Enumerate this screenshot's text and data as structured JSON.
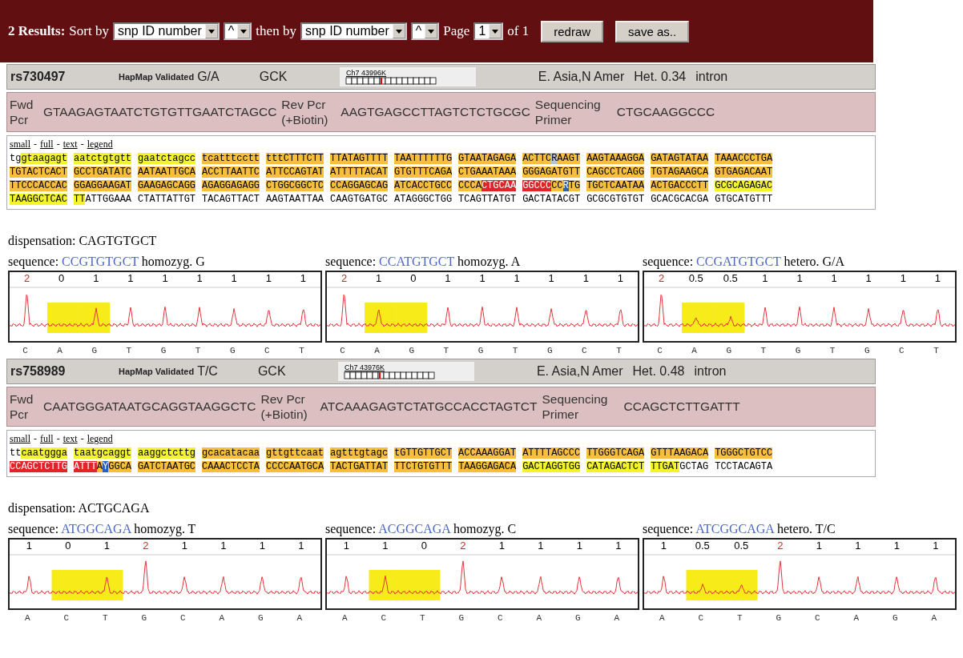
{
  "toolbar": {
    "results": "2 Results:",
    "sort_label": "Sort by",
    "sort_field": "snp ID number",
    "sort_order": "^",
    "then_label": "then by",
    "then_field": "snp ID number",
    "then_order": "^",
    "page_label": "Page",
    "page": "1",
    "page_total": "of 1",
    "buttons": [
      "redraw",
      "save as.."
    ]
  },
  "snps": [
    {
      "id": "rs730497",
      "validation": "HapMap Validated",
      "alleles": "G/A",
      "gene": "GCK",
      "chrom_label": "Ch7 43996K",
      "populations": "E. Asia,N Amer",
      "het": "Het. 0.34",
      "region": "intron",
      "primers": [
        {
          "label": "Fwd Pcr",
          "sequence": "GTAAGAGTAATCTGTGTTGAATCTAGCC"
        },
        {
          "label": "Rev Pcr (+Biotin)",
          "sequence": "AAGTGAGCCTTAGTCTCTGCGC"
        },
        {
          "label": "Sequencing Primer",
          "sequence": "CTGCAAGGCCC"
        }
      ],
      "views": [
        {
          "kind": "link",
          "text": "small"
        },
        {
          "kind": "sep",
          "text": "-"
        },
        {
          "kind": "link",
          "text": "full"
        },
        {
          "kind": "sep",
          "text": "-"
        },
        {
          "kind": "link",
          "text": "text"
        },
        {
          "kind": "sep",
          "text": "-"
        },
        {
          "kind": "link",
          "text": "legend"
        }
      ],
      "sequence_rows": [
        [
          [
            {
              "t": "tg"
            },
            {
              "t": "gtaagagt",
              "color": "#f4f42a"
            }
          ],
          [
            {
              "t": "aatctgtgtt",
              "color": "#f4f42a"
            }
          ],
          [
            {
              "t": "gaatctagcc",
              "color": "#f4f42a"
            }
          ],
          [
            {
              "t": "tcatttcctt",
              "color": "#f8bf3d"
            }
          ],
          [
            {
              "t": "tttCTTTCTT",
              "color": "#f8bf3d"
            }
          ],
          [
            {
              "t": "TTATAGTTTT",
              "color": "#f8bf3d"
            }
          ],
          [
            {
              "t": "TAATTTTTTG",
              "color": "#f8bf3d"
            }
          ],
          [
            {
              "t": "GTAATAGAGA",
              "color": "#f8bf3d"
            }
          ],
          [
            {
              "t": "ACTTC",
              "color": "#f8bf3d"
            },
            {
              "t": "R",
              "color": "#b7c3d6"
            },
            {
              "t": "AAGT",
              "color": "#f8bf3d"
            }
          ],
          [
            {
              "t": "AAGTAAAGGA",
              "color": "#f8bf3d"
            }
          ],
          [
            {
              "t": "GATAGTATAA",
              "color": "#f8bf3d"
            }
          ],
          [
            {
              "t": "TAAACCCTGA",
              "color": "#f8bf3d"
            }
          ]
        ],
        [
          [
            {
              "t": "TGTACTCACT",
              "color": "#f8bf3d"
            }
          ],
          [
            {
              "t": "GCCTGATATC",
              "color": "#f8bf3d"
            }
          ],
          [
            {
              "t": "AATAATTGCA",
              "color": "#f8bf3d"
            }
          ],
          [
            {
              "t": "ACCTTAATTC",
              "color": "#f8bf3d"
            }
          ],
          [
            {
              "t": "ATTCCAGTAT",
              "color": "#f8bf3d"
            }
          ],
          [
            {
              "t": "ATTTTTACAT",
              "color": "#f8bf3d"
            }
          ],
          [
            {
              "t": "GTGTTTCAGA",
              "color": "#f8bf3d"
            }
          ],
          [
            {
              "t": "CTGAAATAAA",
              "color": "#f8bf3d"
            }
          ],
          [
            {
              "t": "GGGAGATGTT",
              "color": "#f8bf3d"
            }
          ],
          [
            {
              "t": "CAGCCTCAGG",
              "color": "#f8bf3d"
            }
          ],
          [
            {
              "t": "TGTAGAAGCA",
              "color": "#f8bf3d"
            }
          ],
          [
            {
              "t": "GTGAGACAAT",
              "color": "#f8bf3d"
            }
          ]
        ],
        [
          [
            {
              "t": "TTCCCACCAC",
              "color": "#f8bf3d"
            }
          ],
          [
            {
              "t": "GGAGGAAGAT",
              "color": "#f8bf3d"
            }
          ],
          [
            {
              "t": "GAAGAGCAGG",
              "color": "#f8bf3d"
            }
          ],
          [
            {
              "t": "AGAGGAGAGG",
              "color": "#f8bf3d"
            }
          ],
          [
            {
              "t": "CTGGCGGCTC",
              "color": "#f8bf3d"
            }
          ],
          [
            {
              "t": "CCAGGAGCAG",
              "color": "#f8bf3d"
            }
          ],
          [
            {
              "t": "ATCACCTGCC",
              "color": "#f8bf3d"
            }
          ],
          [
            {
              "t": "CCCA",
              "color": "#f8bf3d"
            },
            {
              "t": "CTGCAA",
              "color": "#e2232a"
            }
          ],
          [
            {
              "t": "GGCCC",
              "color": "#e2232a"
            },
            {
              "t": "CC",
              "color": "#f8bf3d"
            },
            {
              "t": "R",
              "color": "#2d5fbf"
            },
            {
              "t": "TG",
              "color": "#f8bf3d"
            }
          ],
          [
            {
              "t": "TGCTCAATAA",
              "color": "#f8bf3d"
            }
          ],
          [
            {
              "t": "ACTGACCCTT",
              "color": "#f8bf3d"
            }
          ],
          [
            {
              "t": "GCGCAGAGAC",
              "color": "#f4f42a"
            }
          ]
        ],
        [
          [
            {
              "t": "TAAGGCTCAC",
              "color": "#f4f42a"
            }
          ],
          [
            {
              "t": "TT",
              "color": "#f4f42a"
            },
            {
              "t": "ATTGGAAA"
            }
          ],
          [
            {
              "t": "CTATTATTGT"
            }
          ],
          [
            {
              "t": "TACAGTTACT"
            }
          ],
          [
            {
              "t": "AAGTAATTAA"
            }
          ],
          [
            {
              "t": "CAAGTGATGC"
            }
          ],
          [
            {
              "t": "ATAGGGCTGG"
            }
          ],
          [
            {
              "t": "TCAGTTATGT"
            }
          ],
          [
            {
              "t": "GACTATACGT"
            }
          ],
          [
            {
              "t": "GCGCGTGTGT"
            }
          ],
          [
            {
              "t": "GCACGCACGA"
            }
          ],
          [
            {
              "t": "GTGCATGTTT"
            }
          ]
        ]
      ],
      "dispensation": "dispensation: CAGTGTGCT",
      "pyrograms": [
        {
          "label": "sequence:",
          "sequence": "CCGTGTGCT",
          "genotype": "homozyg. G",
          "peaks": [
            {
              "value": "2",
              "base": "C",
              "marked": true,
              "shaded": false
            },
            {
              "value": "0",
              "base": "A",
              "marked": false,
              "shaded": true
            },
            {
              "value": "1",
              "base": "G",
              "marked": false,
              "shaded": true
            },
            {
              "value": "1",
              "base": "T",
              "marked": false,
              "shaded": false
            },
            {
              "value": "1",
              "base": "G",
              "marked": false,
              "shaded": false
            },
            {
              "value": "1",
              "base": "T",
              "marked": false,
              "shaded": false
            },
            {
              "value": "1",
              "base": "G",
              "marked": false,
              "shaded": false
            },
            {
              "value": "1",
              "base": "C",
              "marked": false,
              "shaded": false
            },
            {
              "value": "1",
              "base": "T",
              "marked": false,
              "shaded": false
            }
          ]
        },
        {
          "label": "sequence:",
          "sequence": "CCATGTGCT",
          "genotype": "homozyg. A",
          "peaks": [
            {
              "value": "2",
              "base": "C",
              "marked": true,
              "shaded": false
            },
            {
              "value": "1",
              "base": "A",
              "marked": false,
              "shaded": true
            },
            {
              "value": "0",
              "base": "G",
              "marked": false,
              "shaded": true
            },
            {
              "value": "1",
              "base": "T",
              "marked": false,
              "shaded": false
            },
            {
              "value": "1",
              "base": "G",
              "marked": false,
              "shaded": false
            },
            {
              "value": "1",
              "base": "T",
              "marked": false,
              "shaded": false
            },
            {
              "value": "1",
              "base": "G",
              "marked": false,
              "shaded": false
            },
            {
              "value": "1",
              "base": "C",
              "marked": false,
              "shaded": false
            },
            {
              "value": "1",
              "base": "T",
              "marked": false,
              "shaded": false
            }
          ]
        },
        {
          "label": "sequence:",
          "sequence": "CCGATGTGCT",
          "genotype": "hetero. G/A",
          "peaks": [
            {
              "value": "2",
              "base": "C",
              "marked": true,
              "shaded": false
            },
            {
              "value": "0.5",
              "base": "A",
              "marked": false,
              "shaded": true
            },
            {
              "value": "0.5",
              "base": "G",
              "marked": false,
              "shaded": true
            },
            {
              "value": "1",
              "base": "T",
              "marked": false,
              "shaded": false
            },
            {
              "value": "1",
              "base": "G",
              "marked": false,
              "shaded": false
            },
            {
              "value": "1",
              "base": "T",
              "marked": false,
              "shaded": false
            },
            {
              "value": "1",
              "base": "G",
              "marked": false,
              "shaded": false
            },
            {
              "value": "1",
              "base": "C",
              "marked": false,
              "shaded": false
            },
            {
              "value": "1",
              "base": "T",
              "marked": false,
              "shaded": false
            }
          ]
        }
      ]
    },
    {
      "id": "rs758989",
      "validation": "HapMap Validated",
      "alleles": "T/C",
      "gene": "GCK",
      "chrom_label": "Ch7 43976K",
      "populations": "E. Asia,N Amer",
      "het": "Het. 0.48",
      "region": "intron",
      "primers": [
        {
          "label": "Fwd Pcr",
          "sequence": "CAATGGGATAATGCAGGTAAGGCTC"
        },
        {
          "label": "Rev Pcr (+Biotin)",
          "sequence": "ATCAAAGAGTCTATGCCACCTAGTCT"
        },
        {
          "label": "Sequencing Primer",
          "sequence": "CCAGCTCTTGATTT"
        }
      ],
      "views": [
        {
          "kind": "link",
          "text": "small"
        },
        {
          "kind": "sep",
          "text": "-"
        },
        {
          "kind": "link",
          "text": "full"
        },
        {
          "kind": "sep",
          "text": "-"
        },
        {
          "kind": "link",
          "text": "text"
        },
        {
          "kind": "sep",
          "text": "-"
        },
        {
          "kind": "link",
          "text": "legend"
        }
      ],
      "sequence_rows": [
        [
          [
            {
              "t": "tt"
            },
            {
              "t": "caatggga",
              "color": "#f4f42a"
            }
          ],
          [
            {
              "t": "taatgcaggt",
              "color": "#f4f42a"
            }
          ],
          [
            {
              "t": "aaggctcttg",
              "color": "#f4f42a"
            }
          ],
          [
            {
              "t": "gcacatacaa",
              "color": "#f8bf3d"
            }
          ],
          [
            {
              "t": "gttgttcaat",
              "color": "#f8bf3d"
            }
          ],
          [
            {
              "t": "agtttgtagc",
              "color": "#f8bf3d"
            }
          ],
          [
            {
              "t": "tGTTGTTGCT",
              "color": "#f8bf3d"
            }
          ],
          [
            {
              "t": "ACCAAAGGAT",
              "color": "#f8bf3d"
            }
          ],
          [
            {
              "t": "ATTTTAGCCC",
              "color": "#f8bf3d"
            }
          ],
          [
            {
              "t": "TTGGGTCAGA",
              "color": "#f8bf3d"
            }
          ],
          [
            {
              "t": "GTTTAAGACA",
              "color": "#f8bf3d"
            }
          ],
          [
            {
              "t": "TGGGCTGTCC",
              "color": "#f8bf3d"
            }
          ]
        ],
        [
          [
            {
              "t": "CCAGCTCTTG",
              "color": "#e2232a"
            }
          ],
          [
            {
              "t": "ATTT",
              "color": "#e2232a"
            },
            {
              "t": "A",
              "color": "#f8bf3d"
            },
            {
              "t": "Y",
              "color": "#2d5fbf"
            },
            {
              "t": "GGCA",
              "color": "#f8bf3d"
            }
          ],
          [
            {
              "t": "GATCTAATGC",
              "color": "#f8bf3d"
            }
          ],
          [
            {
              "t": "CAAACTCCTA",
              "color": "#f8bf3d"
            }
          ],
          [
            {
              "t": "CCCCAATGCA",
              "color": "#f8bf3d"
            }
          ],
          [
            {
              "t": "TACTGATTAT",
              "color": "#f8bf3d"
            }
          ],
          [
            {
              "t": "TTCTGTGTTT",
              "color": "#f8bf3d"
            }
          ],
          [
            {
              "t": "TAAGGAGACA",
              "color": "#f8bf3d"
            }
          ],
          [
            {
              "t": "GACTAGGTGG",
              "color": "#f4f42a"
            }
          ],
          [
            {
              "t": "CATAGACTCT",
              "color": "#f4f42a"
            }
          ],
          [
            {
              "t": "TTGAT",
              "color": "#f4f42a"
            },
            {
              "t": "GCTAG"
            }
          ],
          [
            {
              "t": "TCCTACAGTA"
            }
          ]
        ]
      ],
      "dispensation": "dispensation: ACTGCAGA",
      "pyrograms": [
        {
          "label": "sequence:",
          "sequence": "ATGGCAGA",
          "genotype": "homozyg. T",
          "peaks": [
            {
              "value": "1",
              "base": "A",
              "marked": false,
              "shaded": false
            },
            {
              "value": "0",
              "base": "C",
              "marked": false,
              "shaded": true
            },
            {
              "value": "1",
              "base": "T",
              "marked": false,
              "shaded": true
            },
            {
              "value": "2",
              "base": "G",
              "marked": true,
              "shaded": false
            },
            {
              "value": "1",
              "base": "C",
              "marked": false,
              "shaded": false
            },
            {
              "value": "1",
              "base": "A",
              "marked": false,
              "shaded": false
            },
            {
              "value": "1",
              "base": "G",
              "marked": false,
              "shaded": false
            },
            {
              "value": "1",
              "base": "A",
              "marked": false,
              "shaded": false
            }
          ]
        },
        {
          "label": "sequence:",
          "sequence": "ACGGCAGA",
          "genotype": "homozyg. C",
          "peaks": [
            {
              "value": "1",
              "base": "A",
              "marked": false,
              "shaded": false
            },
            {
              "value": "1",
              "base": "C",
              "marked": false,
              "shaded": true
            },
            {
              "value": "0",
              "base": "T",
              "marked": false,
              "shaded": true
            },
            {
              "value": "2",
              "base": "G",
              "marked": true,
              "shaded": false
            },
            {
              "value": "1",
              "base": "C",
              "marked": false,
              "shaded": false
            },
            {
              "value": "1",
              "base": "A",
              "marked": false,
              "shaded": false
            },
            {
              "value": "1",
              "base": "G",
              "marked": false,
              "shaded": false
            },
            {
              "value": "1",
              "base": "A",
              "marked": false,
              "shaded": false
            }
          ]
        },
        {
          "label": "sequence:",
          "sequence": "ATCGGCAGA",
          "genotype": "hetero. T/C",
          "peaks": [
            {
              "value": "1",
              "base": "A",
              "marked": false,
              "shaded": false
            },
            {
              "value": "0.5",
              "base": "C",
              "marked": false,
              "shaded": true
            },
            {
              "value": "0.5",
              "base": "T",
              "marked": false,
              "shaded": true
            },
            {
              "value": "2",
              "base": "G",
              "marked": true,
              "shaded": false
            },
            {
              "value": "1",
              "base": "C",
              "marked": false,
              "shaded": false
            },
            {
              "value": "1",
              "base": "A",
              "marked": false,
              "shaded": false
            },
            {
              "value": "1",
              "base": "G",
              "marked": false,
              "shaded": false
            },
            {
              "value": "1",
              "base": "A",
              "marked": false,
              "shaded": false
            }
          ]
        }
      ]
    }
  ]
}
